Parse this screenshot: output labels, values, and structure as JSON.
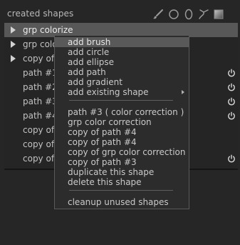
{
  "header": {
    "title": "created shapes",
    "tools": [
      {
        "icon": "brush-icon"
      },
      {
        "icon": "circle-icon"
      },
      {
        "icon": "ellipse-icon"
      },
      {
        "icon": "path-icon"
      },
      {
        "icon": "gradient-icon"
      }
    ]
  },
  "list": {
    "rows": [
      {
        "label": "grp colorize",
        "expand": true,
        "selected": true,
        "power": false
      },
      {
        "label": "grp colo",
        "expand": true,
        "selected": false,
        "power": false
      },
      {
        "label": "copy of",
        "expand": true,
        "selected": false,
        "power": false
      },
      {
        "label": "path #1",
        "expand": false,
        "selected": false,
        "power": true
      },
      {
        "label": "path #2",
        "expand": false,
        "selected": false,
        "power": true
      },
      {
        "label": "path #3",
        "expand": false,
        "selected": false,
        "power": true
      },
      {
        "label": "path #4",
        "expand": false,
        "selected": false,
        "power": true
      },
      {
        "label": "copy of",
        "expand": false,
        "selected": false,
        "power": false
      },
      {
        "label": "copy of",
        "expand": false,
        "selected": false,
        "power": false
      },
      {
        "label": "copy of",
        "expand": false,
        "selected": false,
        "power": true
      }
    ]
  },
  "context_menu": {
    "groups": [
      [
        {
          "label": "add brush",
          "highlighted": true
        },
        {
          "label": "add circle"
        },
        {
          "label": "add ellipse"
        },
        {
          "label": "add path"
        },
        {
          "label": "add gradient"
        },
        {
          "label": "add existing shape",
          "submenu": true
        }
      ],
      [
        {
          "label": "path #3 ( color correction )"
        },
        {
          "label": "grp color correction"
        },
        {
          "label": "copy of path #4"
        },
        {
          "label": "copy of path #4"
        },
        {
          "label": "copy of grp color correction"
        },
        {
          "label": "copy of path #3"
        },
        {
          "label": "duplicate this shape"
        },
        {
          "label": "delete this shape"
        }
      ],
      [
        {
          "label": "cleanup unused shapes"
        }
      ]
    ]
  },
  "colors": {
    "background": "#262626",
    "selected_row": "#585858",
    "menu_bg": "#2c2c2c",
    "menu_highlight": "#595959",
    "text": "#c2c2c2"
  }
}
